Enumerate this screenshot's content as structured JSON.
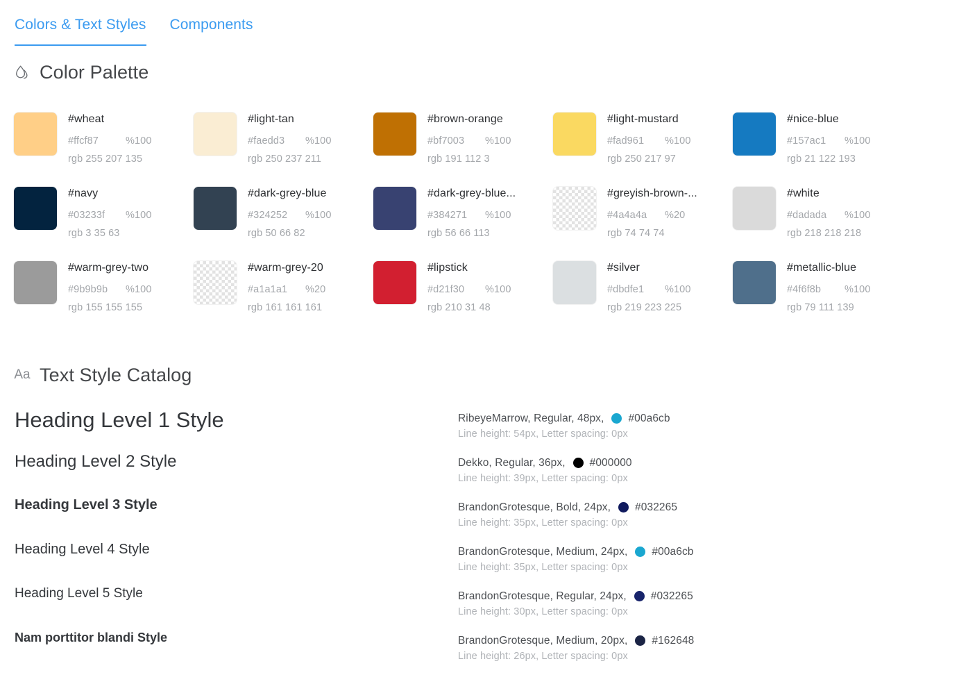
{
  "tabs": [
    {
      "label": "Colors & Text Styles",
      "active": true
    },
    {
      "label": "Components",
      "active": false
    }
  ],
  "accent_color": "#3b9bf0",
  "sections": {
    "palette": {
      "title": "Color Palette",
      "icon": "droplet-icon"
    },
    "text_styles": {
      "title": "Text Style Catalog",
      "icon": "aa-icon",
      "icon_label": "Aa"
    }
  },
  "palette": [
    {
      "name": "#wheat",
      "hex": "#ffcf87",
      "opacity": "%100",
      "rgb": "rgb 255 207 135",
      "swatch": "#ffcf87",
      "transparent": false
    },
    {
      "name": "#light-tan",
      "hex": "#faedd3",
      "opacity": "%100",
      "rgb": "rgb 250 237 211",
      "swatch": "#faedd3",
      "transparent": false
    },
    {
      "name": "#brown-orange",
      "hex": "#bf7003",
      "opacity": "%100",
      "rgb": "rgb 191 112 3",
      "swatch": "#bf7003",
      "transparent": false
    },
    {
      "name": "#light-mustard",
      "hex": "#fad961",
      "opacity": "%100",
      "rgb": "rgb 250 217 97",
      "swatch": "#fad961",
      "transparent": false
    },
    {
      "name": "#nice-blue",
      "hex": "#157ac1",
      "opacity": "%100",
      "rgb": "rgb 21 122 193",
      "swatch": "#157ac1",
      "transparent": false
    },
    {
      "name": "#navy",
      "hex": "#03233f",
      "opacity": "%100",
      "rgb": "rgb 3 35 63",
      "swatch": "#03233f",
      "transparent": false
    },
    {
      "name": "#dark-grey-blue",
      "hex": "#324252",
      "opacity": "%100",
      "rgb": "rgb 50 66 82",
      "swatch": "#324252",
      "transparent": false
    },
    {
      "name": "#dark-grey-blue...",
      "hex": "#384271",
      "opacity": "%100",
      "rgb": "rgb 56 66 113",
      "swatch": "#384271",
      "transparent": false
    },
    {
      "name": "#greyish-brown-...",
      "hex": "#4a4a4a",
      "opacity": "%20",
      "rgb": "rgb 74 74 74",
      "swatch": "#4a4a4a",
      "transparent": true
    },
    {
      "name": "#white",
      "hex": "#dadada",
      "opacity": "%100",
      "rgb": "rgb 218 218 218",
      "swatch": "#dadada",
      "transparent": false
    },
    {
      "name": "#warm-grey-two",
      "hex": "#9b9b9b",
      "opacity": "%100",
      "rgb": "rgb 155 155 155",
      "swatch": "#9b9b9b",
      "transparent": false
    },
    {
      "name": "#warm-grey-20",
      "hex": "#a1a1a1",
      "opacity": "%20",
      "rgb": "rgb 161 161 161",
      "swatch": "#a1a1a1",
      "transparent": true
    },
    {
      "name": "#lipstick",
      "hex": "#d21f30",
      "opacity": "%100",
      "rgb": "rgb 210 31 48",
      "swatch": "#d21f30",
      "transparent": false
    },
    {
      "name": "#silver",
      "hex": "#dbdfe1",
      "opacity": "%100",
      "rgb": "rgb 219 223 225",
      "swatch": "#dbdfe1",
      "transparent": false
    },
    {
      "name": "#metallic-blue",
      "hex": "#4f6f8b",
      "opacity": "%100",
      "rgb": "rgb 79 111 139",
      "swatch": "#4f6f8b",
      "transparent": false
    }
  ],
  "text_styles": [
    {
      "sample": "Heading Level 1 Style",
      "spec": "RibeyeMarrow, Regular, 48px,",
      "color_hex": "#00a6cb",
      "dot_color": "#1aa7d0",
      "details": "Line height: 54px, Letter spacing: 0px",
      "size_class": "s-h1"
    },
    {
      "sample": "Heading Level 2 Style",
      "spec": "Dekko, Regular, 36px,",
      "color_hex": "#000000",
      "dot_color": "#000000",
      "details": "Line height: 39px, Letter spacing: 0px",
      "size_class": "s-h2"
    },
    {
      "sample": "Heading Level 3 Style",
      "spec": "BrandonGrotesque, Bold, 24px,",
      "color_hex": "#032265",
      "dot_color": "#101a5e",
      "details": "Line height: 35px, Letter spacing: 0px",
      "size_class": "s-h3"
    },
    {
      "sample": "Heading Level 4 Style",
      "spec": "BrandonGrotesque, Medium, 24px,",
      "color_hex": "#00a6cb",
      "dot_color": "#1aa7d0",
      "details": "Line height: 35px, Letter spacing: 0px",
      "size_class": "s-h4"
    },
    {
      "sample": "Heading Level 5 Style",
      "spec": "BrandonGrotesque, Regular, 24px,",
      "color_hex": "#032265",
      "dot_color": "#18246b",
      "details": "Line height: 30px, Letter spacing: 0px",
      "size_class": "s-h5"
    },
    {
      "sample": "Nam porttitor blandi Style",
      "spec": "BrandonGrotesque, Medium, 20px,",
      "color_hex": "#162648",
      "dot_color": "#1b2445",
      "details": "Line height: 26px, Letter spacing: 0px",
      "size_class": "s-body"
    }
  ]
}
